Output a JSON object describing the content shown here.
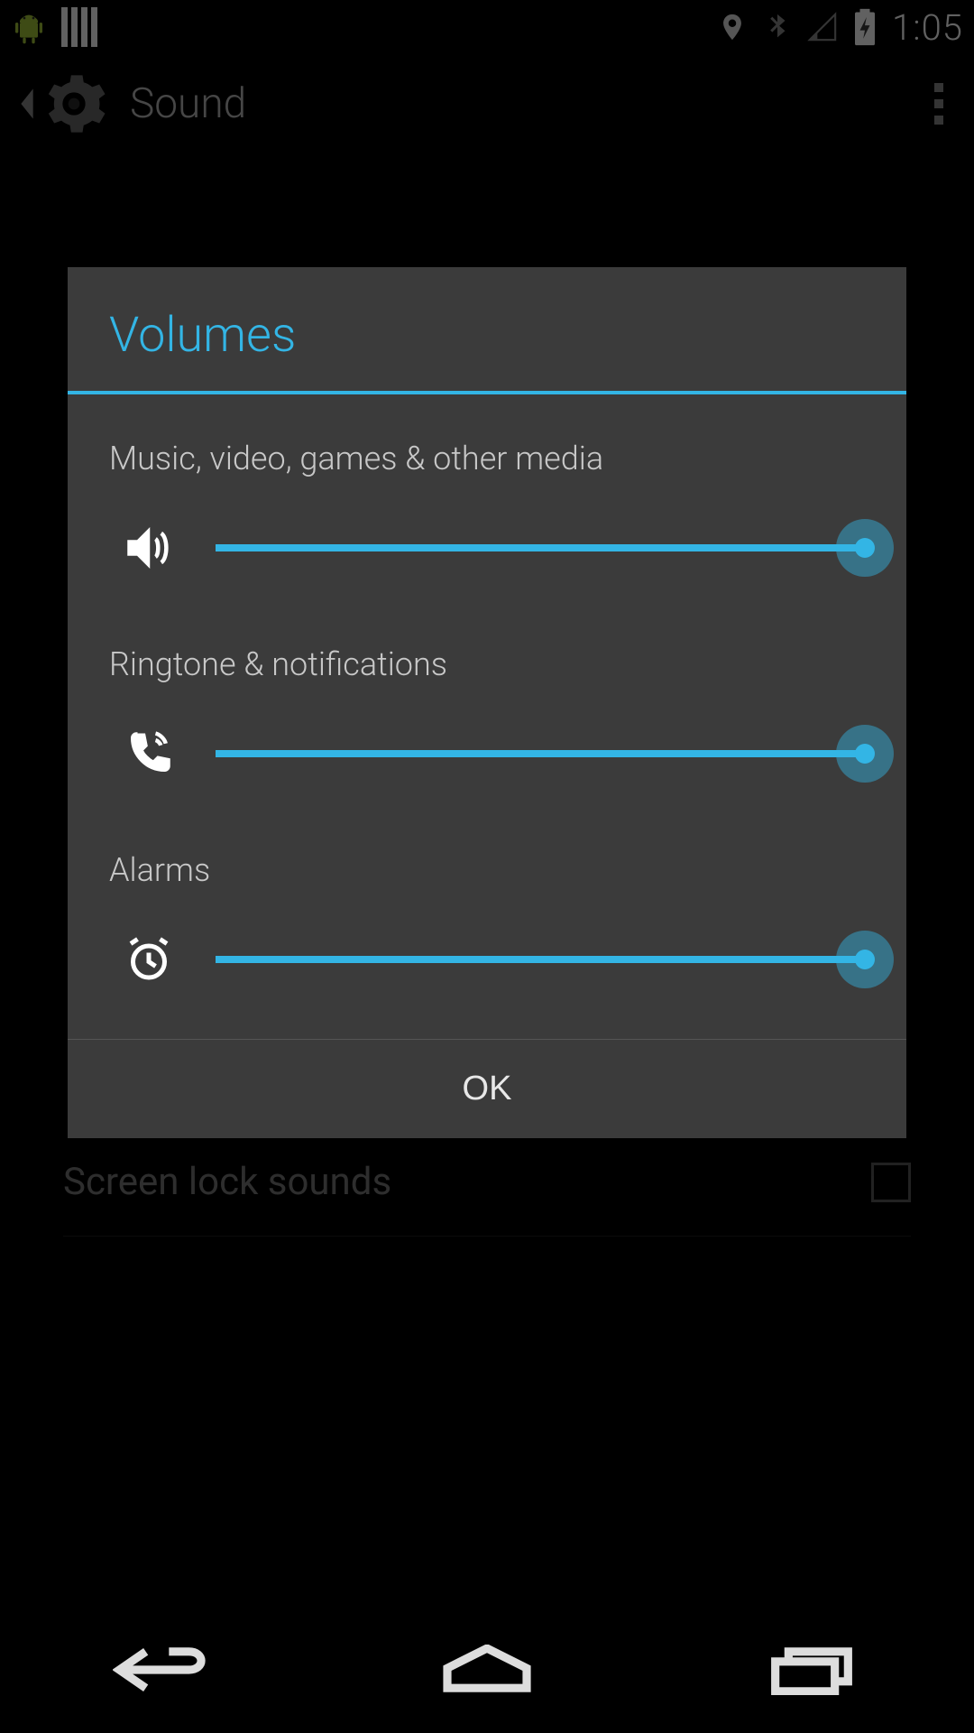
{
  "status": {
    "time": "1:05"
  },
  "actionbar": {
    "title": "Sound"
  },
  "dialog": {
    "title": "Volumes",
    "sliders": {
      "media": {
        "label": "Music, video, games & other media",
        "percent": 100
      },
      "ringtone": {
        "label": "Ringtone & notifications",
        "percent": 100
      },
      "alarms": {
        "label": "Alarms",
        "percent": 100
      }
    },
    "ok_label": "OK"
  },
  "background": {
    "screen_lock_label": "Screen lock sounds",
    "screen_lock_checked": false
  },
  "colors": {
    "accent": "#33b5e5",
    "dialog_bg": "#3b3b3b"
  }
}
